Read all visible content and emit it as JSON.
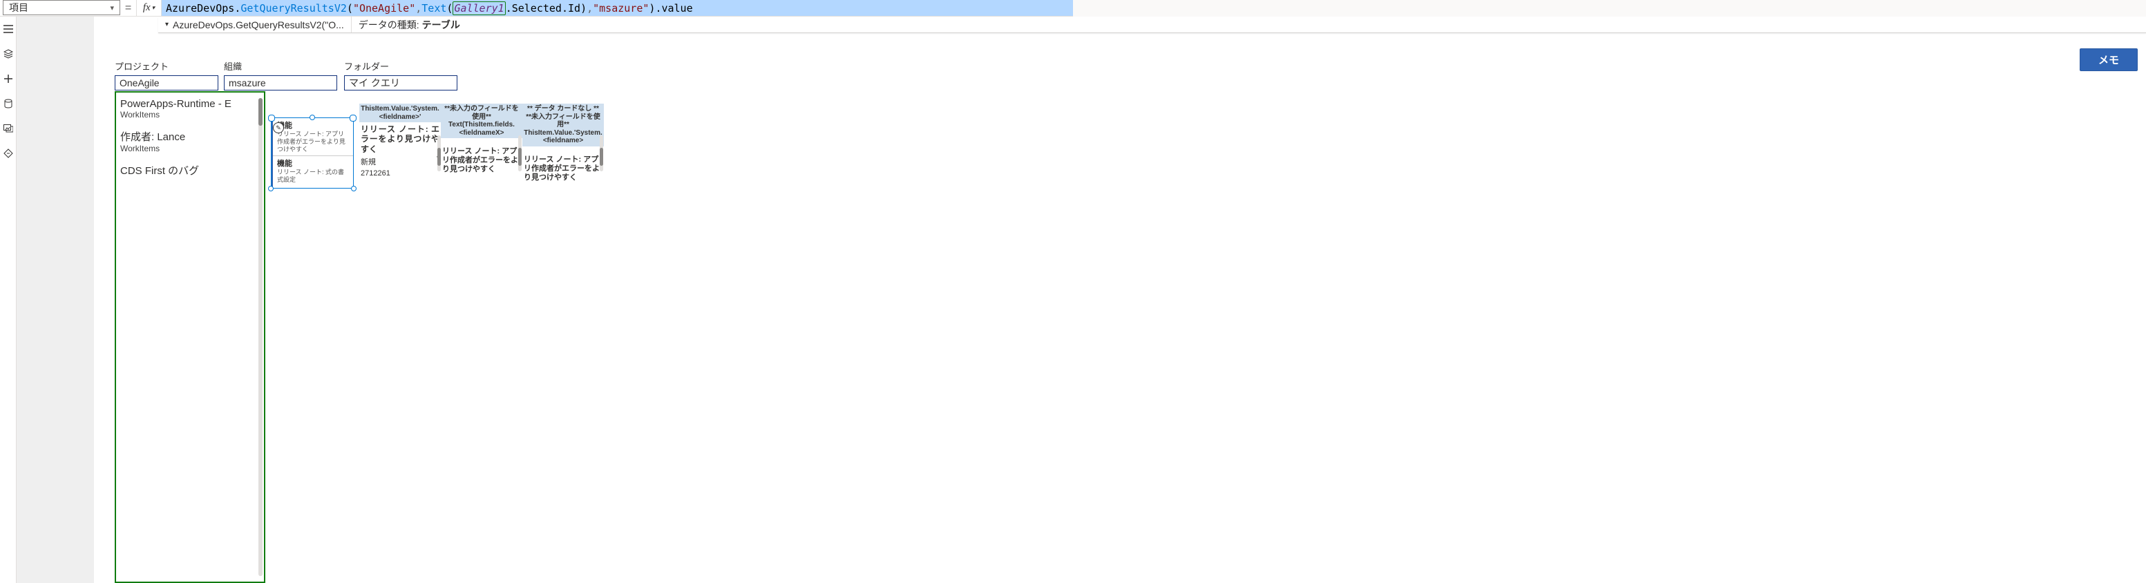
{
  "property_dropdown": {
    "label": "項目"
  },
  "formula_bar": {
    "eq": "=",
    "fx": "fx",
    "tokens": {
      "azure": "AzureDevOps",
      "dot1": ".",
      "fn": "GetQueryResultsV2",
      "open": "(",
      "str1": "\"OneAgile\"",
      "comma1": ", ",
      "textfn": "Text",
      "open2": "(",
      "gallery": "Gallery1",
      "dot2": ".Selected.Id",
      "close2": ")",
      "comma2": ",",
      "str2": "\"msazure\"",
      "close": ")",
      "tail": ".value"
    }
  },
  "intellisense": {
    "summary": "AzureDevOps.GetQueryResultsV2(\"O...",
    "type_label": "データの種類:",
    "type_value": "テーブル"
  },
  "memo_button": "メモ",
  "fields": {
    "project_label": "プロジェクト",
    "project_value": "OneAgile",
    "org_label": "組織",
    "org_value": "msazure",
    "folder_label": "フォルダー",
    "folder_value": "マイ クエリ"
  },
  "gallery": [
    {
      "title": "PowerApps-Runtime - E",
      "sub": "WorkItems"
    },
    {
      "title": "作成者: Lance",
      "sub": "WorkItems"
    },
    {
      "title": "CDS First のバグ",
      "sub": ""
    }
  ],
  "selected_card": {
    "k1": "機能",
    "d1": "リリース ノート: アプリ作成者がエラーをより見つけやすく",
    "k2": "機能",
    "d2": "リリース ノート: 式の書式設定"
  },
  "cards": {
    "c1": {
      "hdr": "ThisItem.Value.'System.<fieldname>'",
      "big": "リリース ノート: エラーをより見つけやすく",
      "r1": "新規",
      "r2": "2712261"
    },
    "c2": {
      "hdr": "**未入力のフィールドを使用** Text(ThisItem.fields.<fieldnameX>",
      "body": "リリース ノート: アプリ作成者がエラーをより見つけやすく"
    },
    "c3": {
      "hdr": "** データ カードなし ** **未入力フィールドを使用** ThisItem.Value.'System.<fieldname>",
      "body": "リリース ノート: アプリ作成者がエラーをより見つけやすく"
    }
  }
}
